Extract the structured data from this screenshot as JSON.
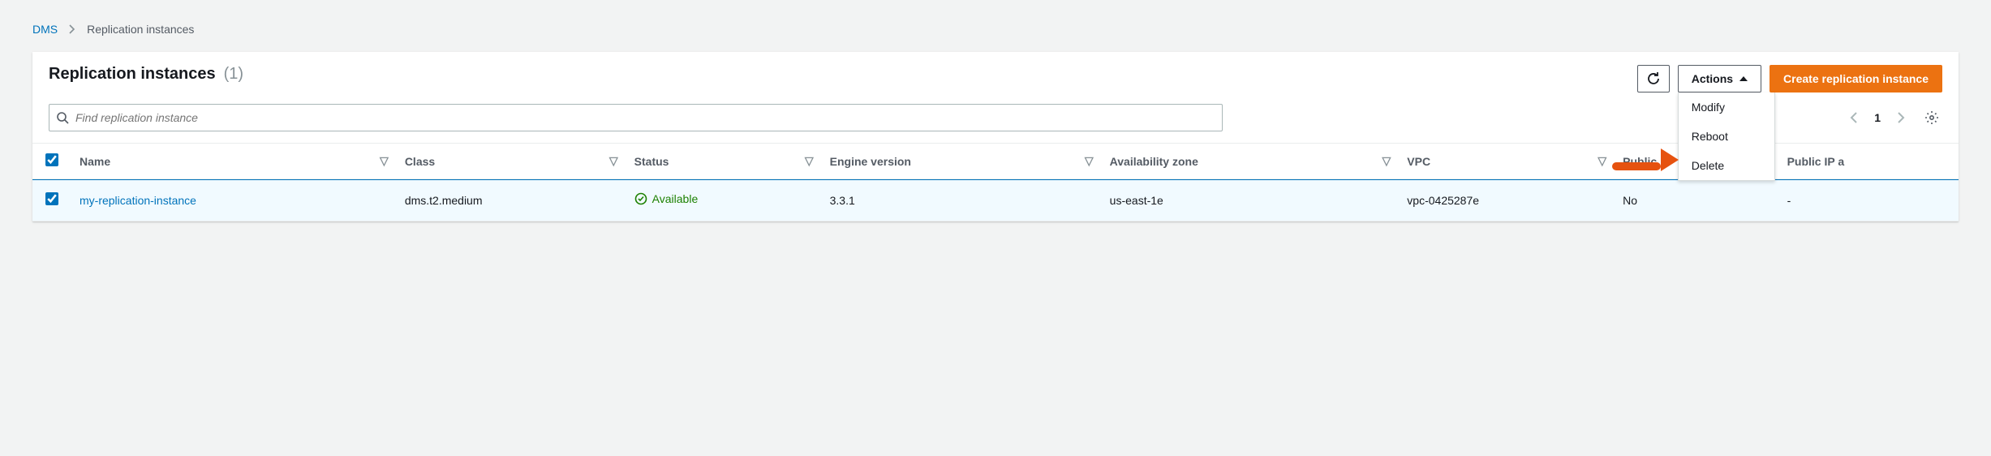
{
  "breadcrumb": {
    "root": "DMS",
    "current": "Replication instances"
  },
  "panel": {
    "title": "Replication instances",
    "count": "(1)"
  },
  "buttons": {
    "actions": "Actions",
    "create": "Create replication instance"
  },
  "actions_menu": [
    "Modify",
    "Reboot",
    "Delete"
  ],
  "search": {
    "placeholder": "Find replication instance"
  },
  "pager": {
    "page": "1"
  },
  "columns": [
    "Name",
    "Class",
    "Status",
    "Engine version",
    "Availability zone",
    "VPC",
    "Public",
    "Public IP a"
  ],
  "rows": [
    {
      "name": "my-replication-instance",
      "class": "dms.t2.medium",
      "status": "Available",
      "engine": "3.3.1",
      "az": "us-east-1e",
      "vpc": "vpc-0425287e",
      "public": "No",
      "ip": "-"
    }
  ]
}
